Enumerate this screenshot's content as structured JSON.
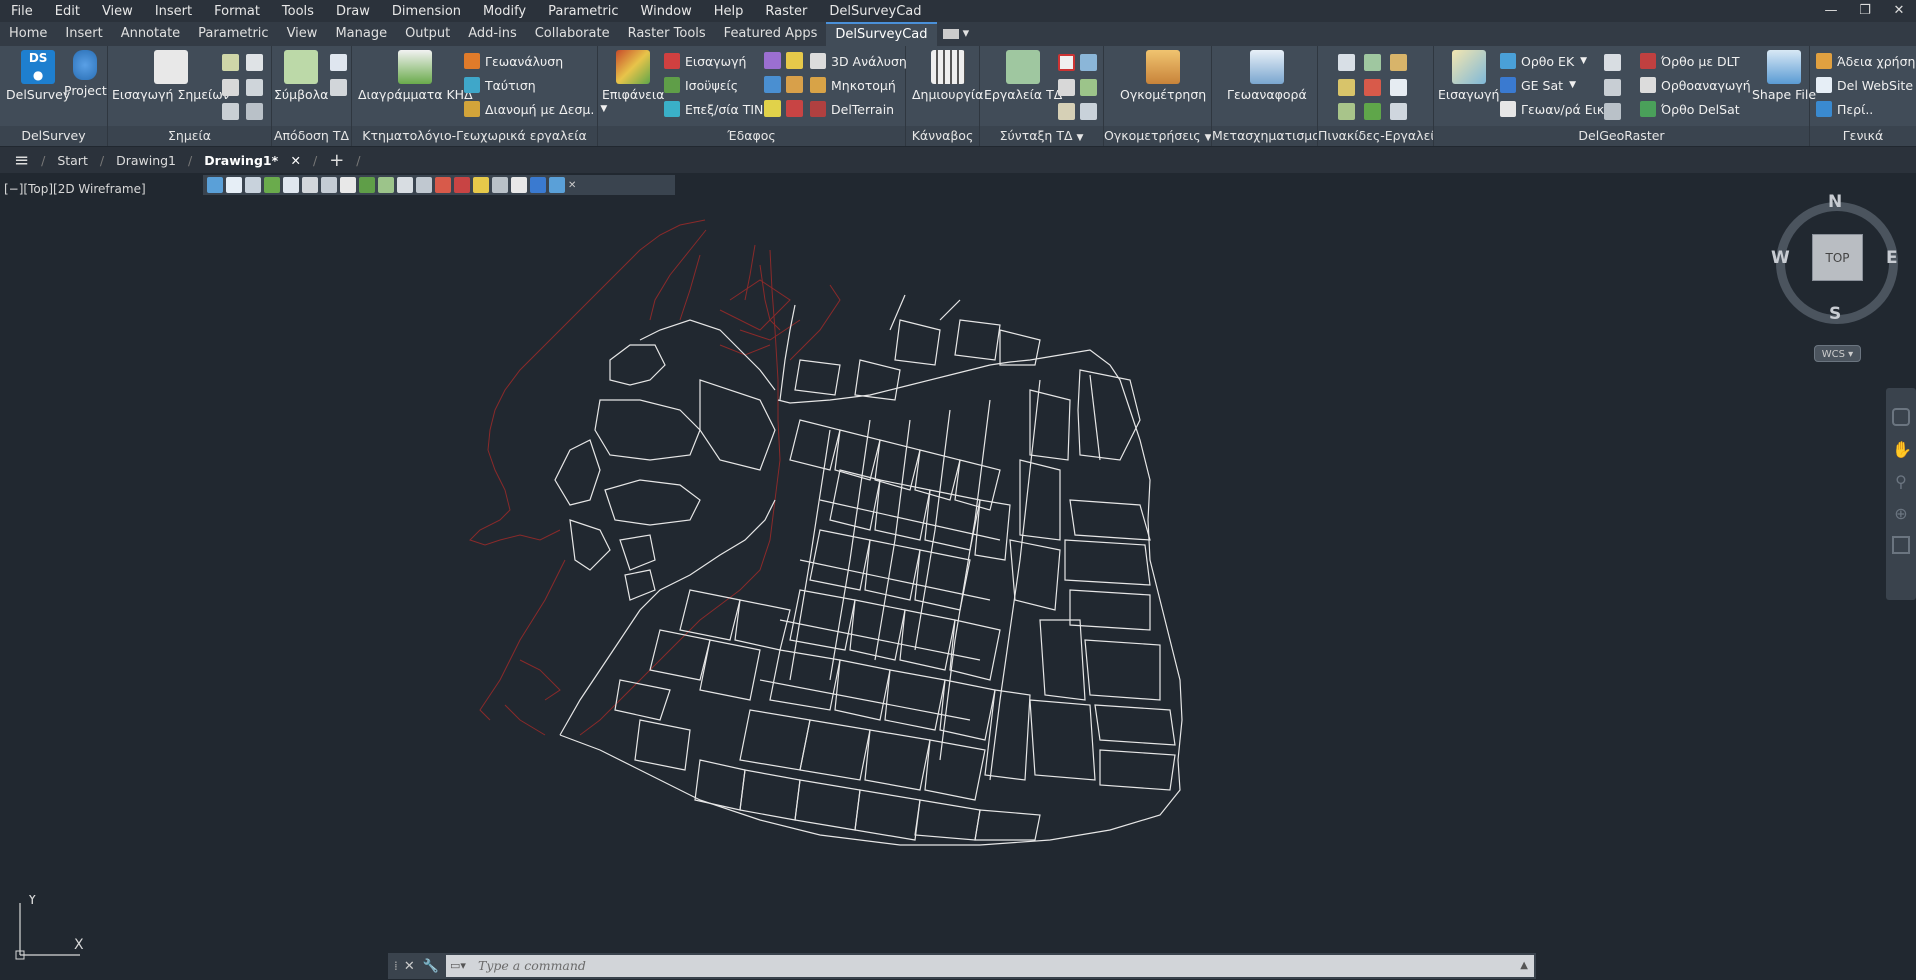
{
  "menubar": {
    "items": [
      "File",
      "Edit",
      "View",
      "Insert",
      "Format",
      "Tools",
      "Draw",
      "Dimension",
      "Modify",
      "Parametric",
      "Window",
      "Help",
      "Raster",
      "DelSurveyCad"
    ],
    "controls": [
      "—",
      "❐",
      "✕"
    ]
  },
  "ribbon_tabs": {
    "items": [
      "Home",
      "Insert",
      "Annotate",
      "Parametric",
      "View",
      "Manage",
      "Output",
      "Add-ins",
      "Collaborate",
      "Raster Tools",
      "Featured Apps",
      "DelSurveyCad"
    ],
    "active": "DelSurveyCad"
  },
  "ribbon": {
    "delsurvey": {
      "title": "DelSurvey",
      "btn1": "DelSurvey",
      "btn2": "Project"
    },
    "simeia": {
      "title": "Σημεία",
      "btn1": "Εισαγωγή Σημείων"
    },
    "apodosi": {
      "title": "Απόδοση ΤΔ",
      "btn1": "Σύμβολα"
    },
    "ktimatologio": {
      "title": "Κτηματολόγιο-Γεωχωρικά εργαλεία",
      "btn1": "Διαγράμματα ΚΗΔ",
      "s1": "Γεωανάλυση",
      "s2": "Ταύτιση",
      "s3": "Διανομή με Δεσμ."
    },
    "edafos": {
      "title": "Έδαφος",
      "btn1": "Επιφάνεια",
      "s1": "Εισαγωγή",
      "s2": "Ισοϋψείς",
      "s3": "Επεξ/σία TIN",
      "s4": "3D Ανάλυση",
      "s5": "Μηκοτομή",
      "s6": "DelTerrain"
    },
    "kanvas": {
      "title": "Κάνναβος",
      "btn1": "Δημιουργία"
    },
    "syntaxi": {
      "title": "Σύνταξη ΤΔ",
      "btn1": "Εργαλεία ΤΔ"
    },
    "ogkometriseis": {
      "title": "Ογκομετρήσεις",
      "btn1": "Ογκομέτρηση"
    },
    "metasx": {
      "title": "Μετασχηματισμοί",
      "btn1": "Γεωαναφορά"
    },
    "pinakides": {
      "title": "Πινακίδες-Εργαλεία"
    },
    "delgeoraster": {
      "title": "DelGeoRaster",
      "btn1": "Εισαγωγή",
      "s1": "Ορθο ΕΚ",
      "s2": "GE Sat",
      "s3": "Γεωαν/ρά Εικ.",
      "s4": "Όρθο με DLT",
      "s5": "Ορθοαναγωγή",
      "s6": "Όρθο DelSat",
      "btn2": "Shape File"
    },
    "genika": {
      "title": "Γενικά",
      "s1": "Άδεια χρήσης",
      "s2": "Del WebSite",
      "s3": "Περί.."
    }
  },
  "doctabs": {
    "start": "Start",
    "drawing1": "Drawing1",
    "drawing1_active": "Drawing1*"
  },
  "viewport": {
    "label": "[−][Top][2D Wireframe]"
  },
  "viewcube": {
    "n": "N",
    "s": "S",
    "e": "E",
    "w": "W",
    "face": "TOP",
    "wcs": "WCS"
  },
  "ucs": {
    "x": "X",
    "y": "Y"
  },
  "command": {
    "placeholder": "Type a command"
  },
  "colors": {
    "accent": "#4a90d9",
    "lines_white": "#e6e6e6",
    "lines_red": "#8a2a2a",
    "background": "#212830"
  }
}
